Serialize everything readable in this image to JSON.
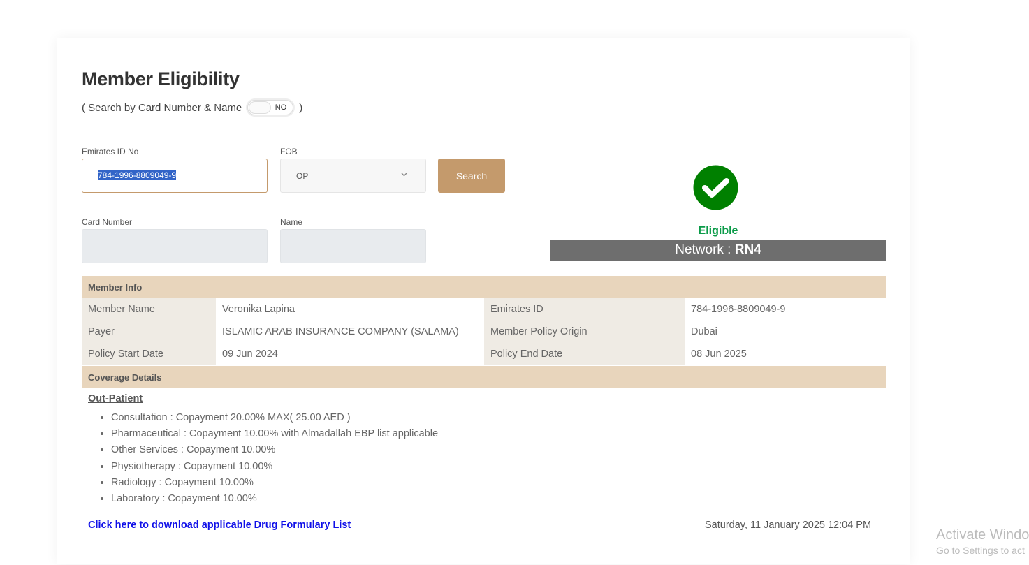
{
  "page": {
    "title": "Member Eligibility",
    "search_by": "( Search by Card Number & Name",
    "search_by_close": ")",
    "toggle": "NO"
  },
  "form": {
    "eid_label": "Emirates ID No",
    "eid_value": "784-1996-8809049-9",
    "fob_label": "FOB",
    "fob_value": "OP",
    "search": "Search",
    "card_label": "Card Number",
    "name_label": "Name"
  },
  "status": {
    "eligible": "Eligible",
    "network_label": "Network : ",
    "network_value": "RN4",
    "color": "#008000"
  },
  "member_info": {
    "title": "Member Info",
    "rows": [
      [
        "Member Name",
        "Veronika Lapina",
        "Emirates ID",
        "784-1996-8809049-9"
      ],
      [
        "Payer",
        "ISLAMIC ARAB INSURANCE COMPANY (SALAMA)",
        "Member Policy Origin",
        "Dubai"
      ],
      [
        "Policy Start Date",
        "09 Jun 2024",
        "Policy End Date",
        "08 Jun 2025"
      ]
    ]
  },
  "coverage": {
    "title": "Coverage Details",
    "section": "Out-Patient",
    "items": [
      "Consultation : Copayment 20.00% MAX( 25.00 AED )",
      "Pharmaceutical : Copayment 10.00% with Almadallah EBP list applicable",
      "Other Services : Copayment 10.00%",
      "Physiotherapy : Copayment 10.00%",
      "Radiology : Copayment 10.00%",
      "Laboratory : Copayment 10.00%"
    ]
  },
  "footer": {
    "download": "Click here to download applicable Drug Formulary List",
    "datetime": "Saturday, 11 January 2025 12:04 PM"
  },
  "watermark": {
    "line1": "Activate Windo",
    "line2": "Go to Settings to act"
  }
}
